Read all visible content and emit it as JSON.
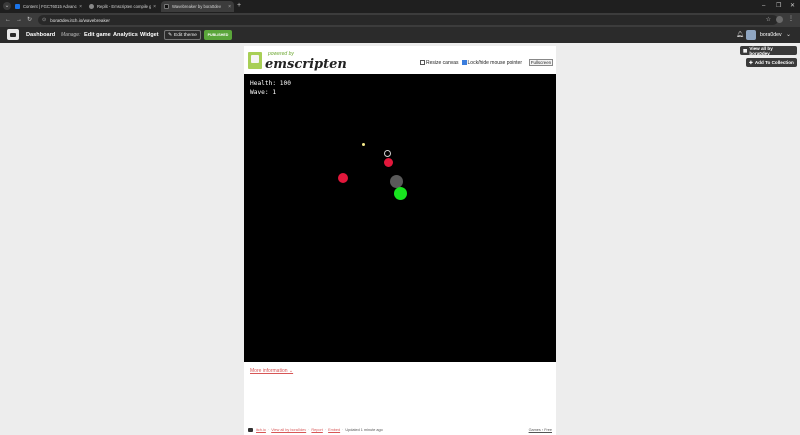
{
  "browser": {
    "tabs": [
      {
        "title": "Content | FGCT6015 Advance...",
        "favicon_color": "#1a73e8",
        "active": false
      },
      {
        "title": "Replit - Emscripten compile g...",
        "favicon_color": "#8a8a8a",
        "active": false
      },
      {
        "title": "Wavebreaker by bora0dev",
        "favicon_color": "#111111",
        "active": true
      }
    ],
    "url": "bora0dev.itch.io/wavebreaker"
  },
  "site_nav": {
    "dashboard": "Dashboard",
    "manage_label": "Manage:",
    "edit_game": "Edit game",
    "analytics": "Analytics",
    "widget": "Widget",
    "edit_theme": "Edit theme",
    "status_badge": "PUBLISHED",
    "username": "bora0dev"
  },
  "side_actions": {
    "view_all": "View all by bora0dev",
    "add_collection": "Add To Collection"
  },
  "emscripten": {
    "powered_by": "powered by",
    "brand": "emscripten",
    "resize_canvas_label": "Resize canvas",
    "resize_canvas_checked": false,
    "lock_pointer_label": "Lock/hide mouse pointer",
    "lock_pointer_checked": true,
    "fullscreen_label": "Fullscreen"
  },
  "game": {
    "health_text": "Health: 100",
    "wave_text": "Wave: 1"
  },
  "page": {
    "more_information": "More information",
    "footer": {
      "itch_link": "itch.io",
      "view_all": "View all by bora0dev",
      "report": "Report",
      "embed": "Embed",
      "updated": "Updated 1 minute ago",
      "right_links": "Games › Free"
    }
  },
  "colors": {
    "enemy": "#e2173b",
    "player": "#18e41f",
    "shadow_enemy": "#595959",
    "bullet": "#f5e98a"
  }
}
